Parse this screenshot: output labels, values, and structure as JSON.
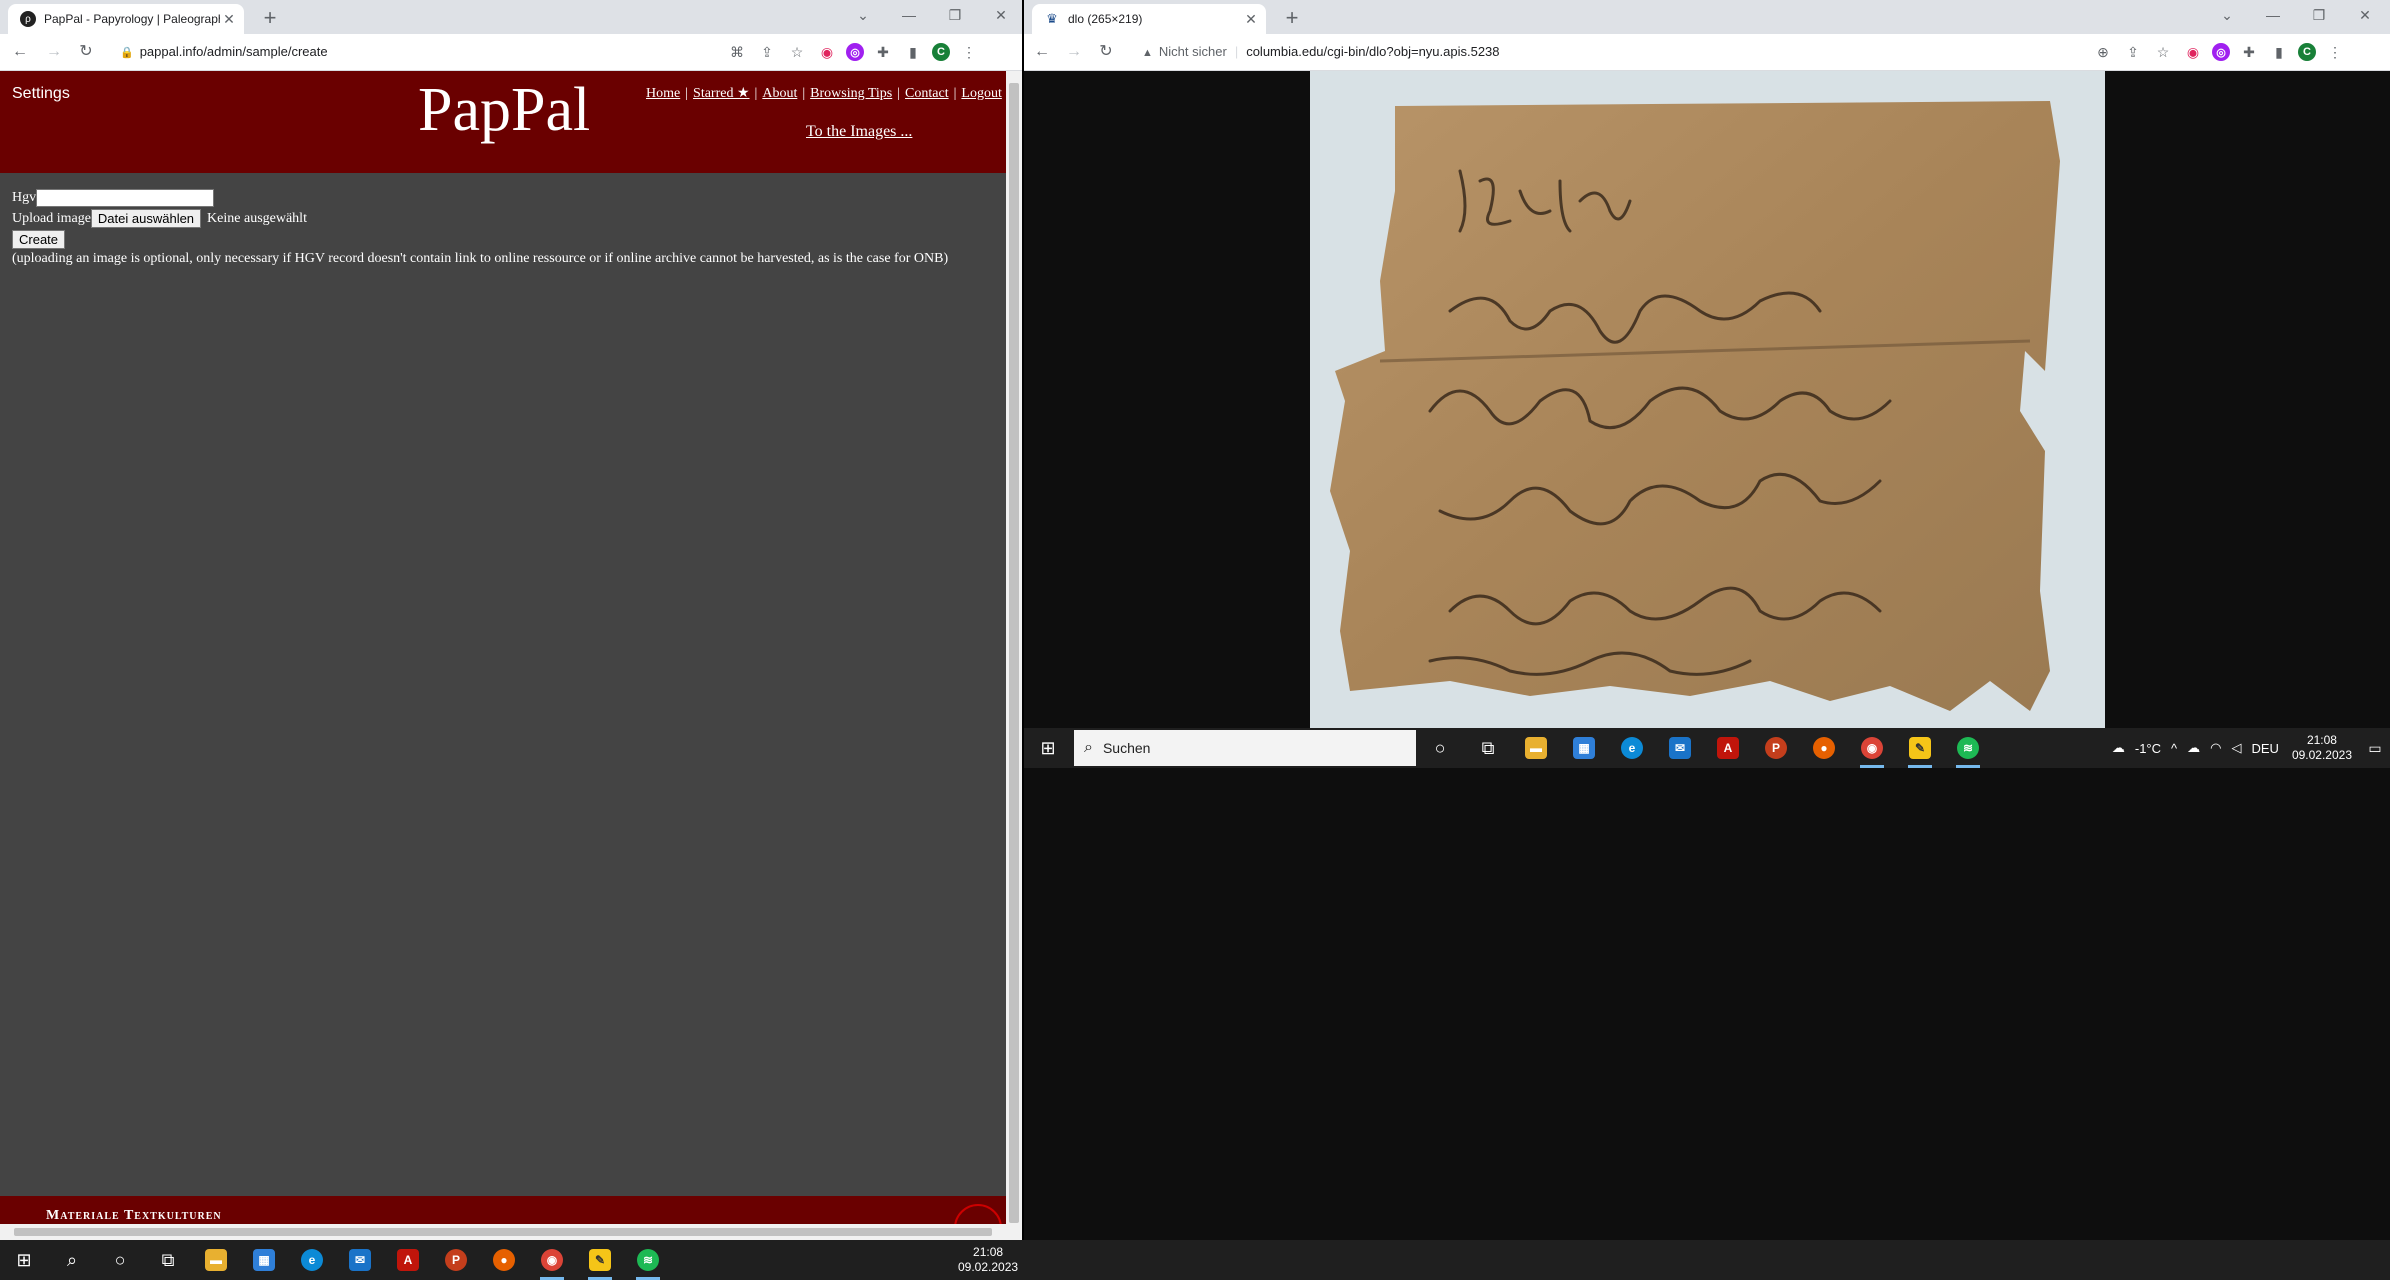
{
  "left_window": {
    "tab_title": "PapPal - Papyrology | Paleograph",
    "tab_icon": "pappal-favicon-icon",
    "url": "pappal.info/admin/sample/create",
    "page": {
      "settings_label": "Settings",
      "logo": "PapPal",
      "nav": [
        "Home",
        "Starred ★",
        "About",
        "Browsing Tips",
        "Contact",
        "Logout"
      ],
      "nav_sep": "|",
      "to_images": "To the Images ...",
      "form": {
        "hgv_label": "Hgv",
        "hgv_value": "",
        "upload_label": "Upload image",
        "file_button": "Datei auswählen",
        "file_status": "Keine ausgewählt",
        "create_button": "Create",
        "note": "(uploading an image is optional, only necessary if HGV record doesn't contain link to online ressource or if online archive cannot be harvested, as is the case for ONB)"
      },
      "footer_title": "Materiale Textkulturen"
    }
  },
  "right_window": {
    "tab_title": "dlo (265×219)",
    "tab_icon": "columbia-crown-icon",
    "security_label": "Nicht sicher",
    "url": "columbia.edu/cgi-bin/dlo?obj=nyu.apis.5238",
    "image": "papyrus fragment photo"
  },
  "taskbar_right": {
    "search_placeholder": "Suchen",
    "weather": "-1°C",
    "language": "DEU",
    "time": "21:08",
    "date": "09.02.2023"
  },
  "taskbar_main": {
    "time": "21:08",
    "date": "09.02.2023"
  },
  "colors": {
    "header_bg": "#6a0000",
    "page_bg": "#444444",
    "taskbar_bg": "#1f1f1f"
  }
}
